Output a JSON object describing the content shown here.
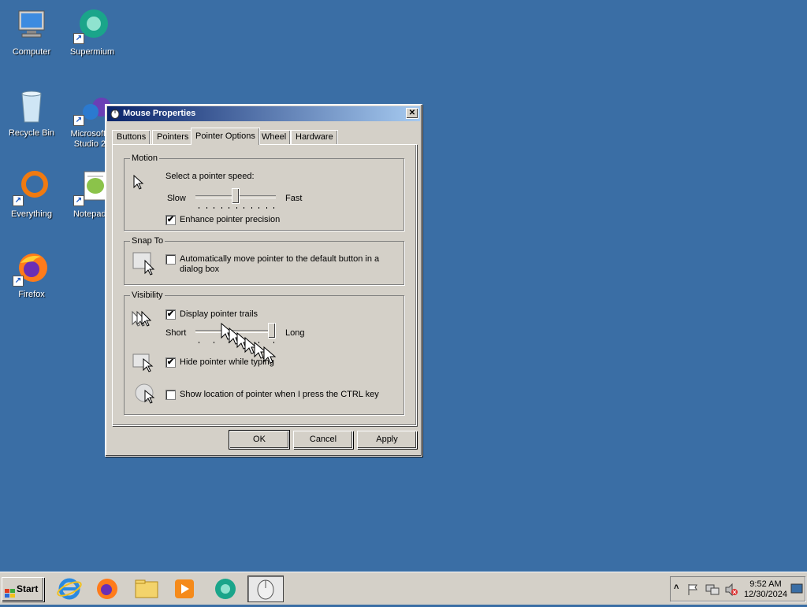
{
  "desktop": {
    "icons": [
      {
        "label": "Computer"
      },
      {
        "label": "Supermium"
      },
      {
        "label": "Recycle Bin"
      },
      {
        "label": "Microsoft V\nStudio 20"
      },
      {
        "label": "Everything"
      },
      {
        "label": "Notepad+"
      },
      {
        "label": "Firefox"
      }
    ]
  },
  "window": {
    "title": "Mouse Properties",
    "close_glyph": "✕",
    "tabs": [
      {
        "label": "Buttons"
      },
      {
        "label": "Pointers"
      },
      {
        "label": "Pointer Options"
      },
      {
        "label": "Wheel"
      },
      {
        "label": "Hardware"
      }
    ],
    "active_tab": "Pointer Options",
    "motion": {
      "legend": "Motion",
      "prompt": "Select a pointer speed:",
      "slow": "Slow",
      "fast": "Fast",
      "speed_level": 0.5,
      "enhance_label": "Enhance pointer precision",
      "enhance_checked": true
    },
    "snap": {
      "legend": "Snap To",
      "label_line1": "Automatically move pointer to the default button in a",
      "label_line2": "dialog box",
      "checked": false
    },
    "visibility": {
      "legend": "Visibility",
      "trails_label": "Display pointer trails",
      "trails_checked": true,
      "short": "Short",
      "long": "Long",
      "trail_level": 1.0,
      "hide_label": "Hide pointer while typing",
      "hide_checked": true,
      "ctrl_label": "Show location of pointer when I press the CTRL key",
      "ctrl_checked": false
    },
    "buttons": {
      "ok": "OK",
      "cancel": "Cancel",
      "apply": "Apply"
    },
    "check_glyph": "✔"
  },
  "taskbar": {
    "start_label": "Start",
    "items": [
      "internet-explorer-icon",
      "firefox-icon",
      "file-explorer-icon",
      "media-player-icon",
      "supermium-icon",
      "mouse-properties-icon"
    ],
    "tray": {
      "chevron": "˄",
      "time": "9:52 AM",
      "date": "12/30/2024"
    }
  },
  "colors": {
    "desktop": "#3a6ea5",
    "titlebar_start": "#0a246a",
    "titlebar_end": "#a6caf0",
    "face": "#d4d0c8"
  }
}
